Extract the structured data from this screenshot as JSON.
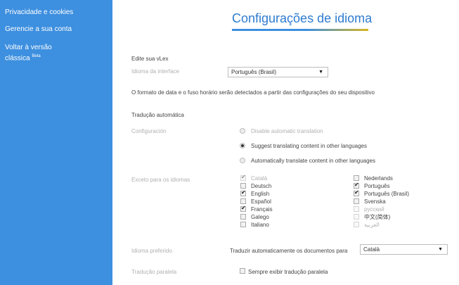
{
  "sidebar": {
    "items": [
      {
        "label": "Privacidade e cookies"
      },
      {
        "label": "Gerencie a sua conta"
      },
      {
        "label": "Voltar à versão"
      },
      {
        "label": "clássica",
        "badge": "Beta"
      }
    ]
  },
  "page": {
    "title": "Configurações de idioma",
    "edit_heading": "Edite sua vLex",
    "interface_label": "Idioma da interface",
    "interface_value": "Português (Brasil)",
    "date_note": "O formato de data e o fuso horário serão detectados a partir das configurações do seu dispositivo",
    "auto_heading": "Tradução automática",
    "config_label": "Configuración",
    "radio_options": [
      {
        "label": "Disable automatic translation",
        "selected": false
      },
      {
        "label": "Suggest translating content in other languages",
        "selected": true
      },
      {
        "label": "Automatically translate content in other languages",
        "selected": false
      }
    ],
    "except_label": "Exceto para os idiomas",
    "languages_col1": [
      {
        "label": "Català",
        "checked": true,
        "disabled": true
      },
      {
        "label": "Deutsch",
        "checked": false,
        "disabled": false
      },
      {
        "label": "English",
        "checked": true,
        "disabled": false
      },
      {
        "label": "Español",
        "checked": false,
        "disabled": false
      },
      {
        "label": "Français",
        "checked": true,
        "disabled": false
      },
      {
        "label": "Galego",
        "checked": false,
        "disabled": false
      },
      {
        "label": "Italiano",
        "checked": false,
        "disabled": false
      }
    ],
    "languages_col2": [
      {
        "label": "Nederlands",
        "checked": false,
        "disabled": false
      },
      {
        "label": "Português",
        "checked": true,
        "disabled": false
      },
      {
        "label": "Português (Brasil)",
        "checked": true,
        "disabled": false
      },
      {
        "label": "Svenska",
        "checked": false,
        "disabled": false
      },
      {
        "label": "русский",
        "checked": false,
        "disabled": true
      },
      {
        "label": "中文(简体)",
        "checked": false,
        "disabled": true
      },
      {
        "label": "العربية",
        "checked": false,
        "disabled": true
      }
    ],
    "preferred_label": "Idioma preferido",
    "preferred_text": "Traduzir automaticamente os documentos para",
    "preferred_value": "Català",
    "parallel_label": "Tradução paralela",
    "parallel_text": "Sempre exibir tradução paralela",
    "parallel_checked": false
  },
  "colors": {
    "sidebar": "#3d8fdf",
    "title": "#2e7bcf",
    "underline_end": "#d8b61f"
  }
}
